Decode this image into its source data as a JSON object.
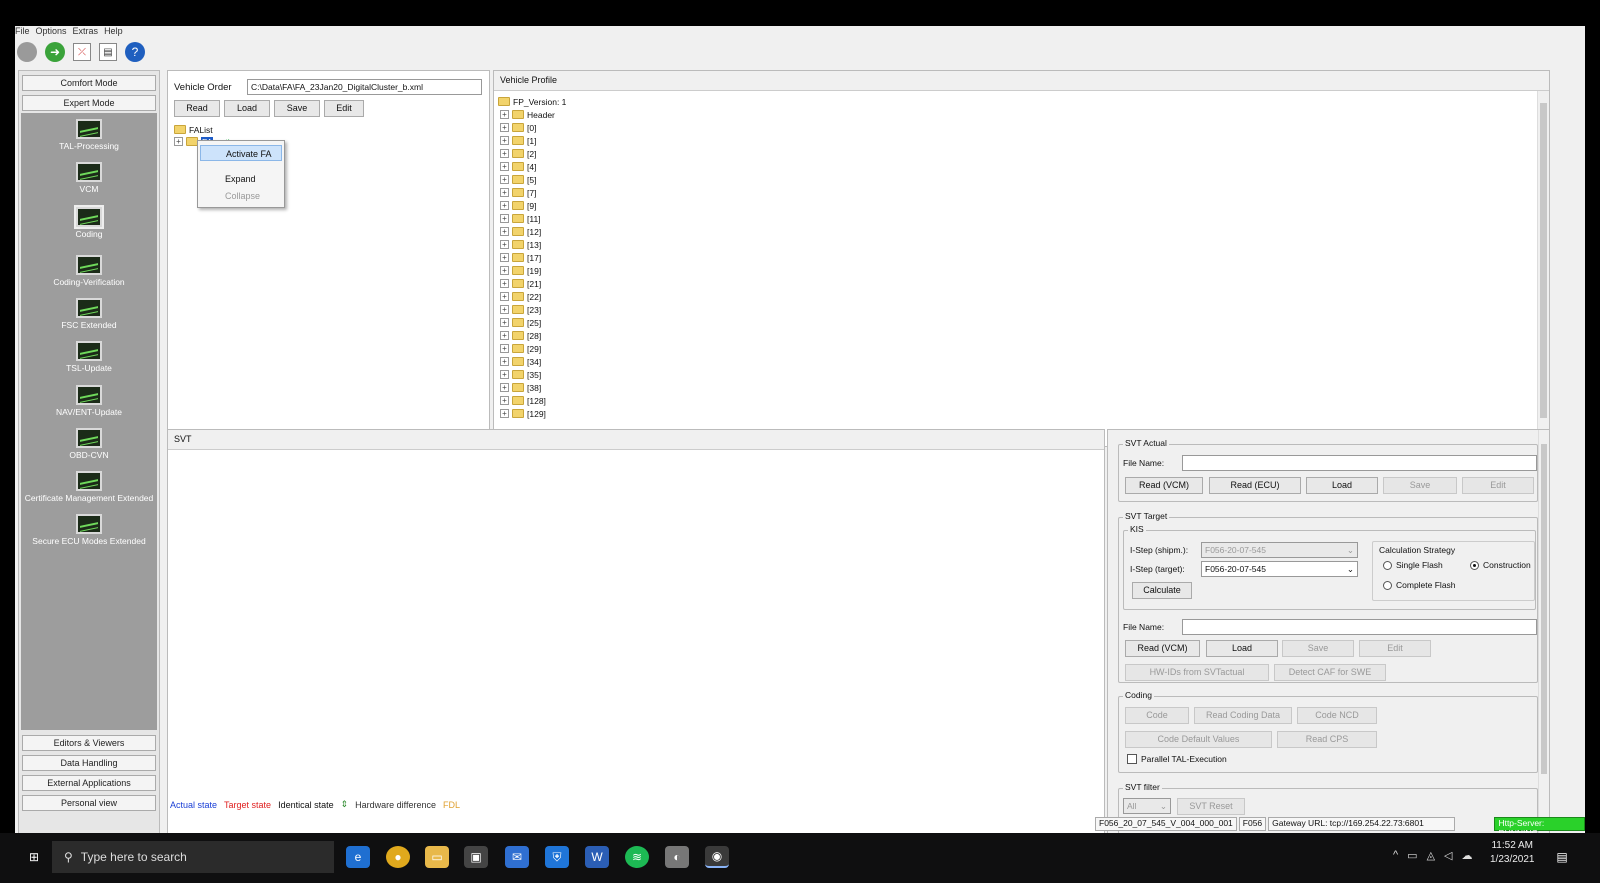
{
  "menubar": [
    "File",
    "Options",
    "Extras",
    "Help"
  ],
  "sidebar": {
    "top_buttons": [
      "Comfort Mode",
      "Expert Mode"
    ],
    "tools": [
      "TAL-Processing",
      "VCM",
      "Coding",
      "Coding-Verification",
      "FSC Extended",
      "TSL-Update",
      "NAV/ENT-Update",
      "OBD-CVN",
      "Certificate Management Extended",
      "Secure ECU Modes Extended"
    ],
    "bottom_buttons": [
      "Editors & Viewers",
      "Data Handling",
      "External Applications",
      "Personal view"
    ]
  },
  "vehicle_order": {
    "label": "Vehicle Order",
    "path": "C:\\Data\\FA\\FA_23Jan20_DigitalCluster_b.xml",
    "buttons": [
      "Read",
      "Load",
      "Save",
      "Edit"
    ],
    "tree_root": "FAList",
    "tree_child": "FA",
    "tree_child_state": "active"
  },
  "context_menu": {
    "items": [
      "Activate FA",
      "Expand",
      "Collapse"
    ]
  },
  "vehicle_profile": {
    "title": "Vehicle Profile",
    "root": "FP_Version: 1",
    "items": [
      "Header",
      "[0]",
      "[1]",
      "[2]",
      "[4]",
      "[5]",
      "[7]",
      "[9]",
      "[11]",
      "[12]",
      "[13]",
      "[17]",
      "[19]",
      "[21]",
      "[22]",
      "[23]",
      "[25]",
      "[28]",
      "[29]",
      "[34]",
      "[35]",
      "[38]",
      "[128]",
      "[129]"
    ]
  },
  "svt": {
    "title": "SVT",
    "legend": [
      {
        "text": "Actual state",
        "color": "#1a3fd6"
      },
      {
        "text": "Target state",
        "color": "#e02020"
      },
      {
        "text": "Identical state",
        "color": "#111111"
      },
      {
        "text": "Hardware difference",
        "color": "#333333"
      },
      {
        "text": "FDL",
        "color": "#e0a030"
      }
    ]
  },
  "svt_actual": {
    "title": "SVT Actual",
    "file_label": "File Name:",
    "buttons": [
      "Read (VCM)",
      "Read (ECU)",
      "Load",
      "Save",
      "Edit"
    ]
  },
  "svt_target": {
    "title": "SVT Target",
    "kis": "KIS",
    "istep_shipm_label": "I-Step (shipm.):",
    "istep_shipm_value": "F056-20-07-545",
    "istep_target_label": "I-Step (target):",
    "istep_target_value": "F056-20-07-545",
    "calculate": "Calculate",
    "strategy_label": "Calculation Strategy",
    "strategy_options": [
      "Single Flash",
      "Complete Flash",
      "Construction"
    ],
    "file_label": "File Name:",
    "buttons": [
      "Read (VCM)",
      "Load",
      "Save",
      "Edit"
    ],
    "buttons2": [
      "HW-IDs from SVTactual",
      "Detect CAF for SWE"
    ]
  },
  "coding": {
    "title": "Coding",
    "buttons": [
      "Code",
      "Read Coding Data",
      "Code NCD"
    ],
    "buttons2": [
      "Code Default Values",
      "Read CPS"
    ],
    "parallel": "Parallel TAL-Execution"
  },
  "svt_filter": {
    "title": "SVT filter",
    "select": "All",
    "reset": "SVT Reset"
  },
  "statusbar": {
    "istep": "F056_20_07_545_V_004_000_001",
    "series": "F056",
    "gateway": "Gateway URL: tcp://169.254.22.73:6801",
    "server": "Http-Server: RUNNING"
  },
  "taskbar": {
    "search_placeholder": "Type here to search",
    "time": "11:52 AM",
    "date": "1/23/2021"
  }
}
